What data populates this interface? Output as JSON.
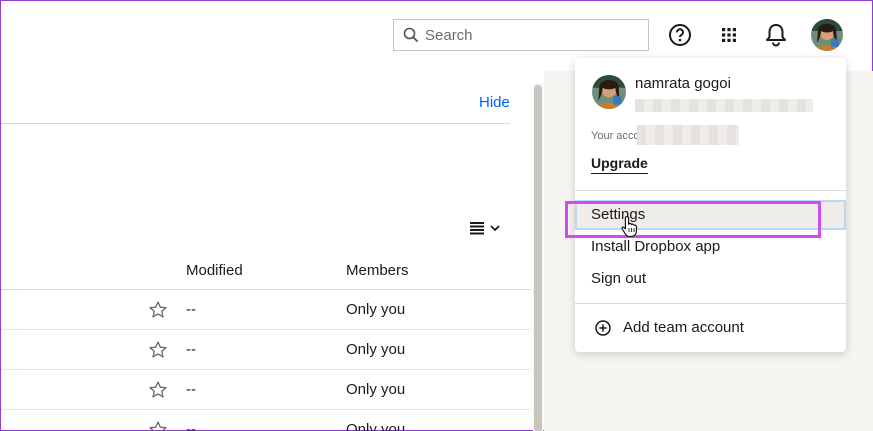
{
  "header": {
    "search_placeholder": "Search",
    "icons": [
      "search-icon",
      "help-icon",
      "apps-grid-icon",
      "bell-icon"
    ]
  },
  "content": {
    "hide_label": "Hide",
    "columns": {
      "modified": "Modified",
      "members": "Members"
    },
    "rows": [
      {
        "modified": "--",
        "members": "Only you"
      },
      {
        "modified": "--",
        "members": "Only you"
      },
      {
        "modified": "--",
        "members": "Only you"
      },
      {
        "modified": "--",
        "members": "Only you"
      }
    ]
  },
  "account_menu": {
    "user_name": "namrata gogoi",
    "account_text": "Your acco",
    "upgrade_label": "Upgrade",
    "items": [
      "Settings",
      "Install Dropbox app",
      "Sign out"
    ],
    "add_team_label": "Add team account"
  },
  "colors": {
    "link": "#0061fe",
    "highlight": "#d04cf0",
    "frame": "#8a3fd1"
  }
}
